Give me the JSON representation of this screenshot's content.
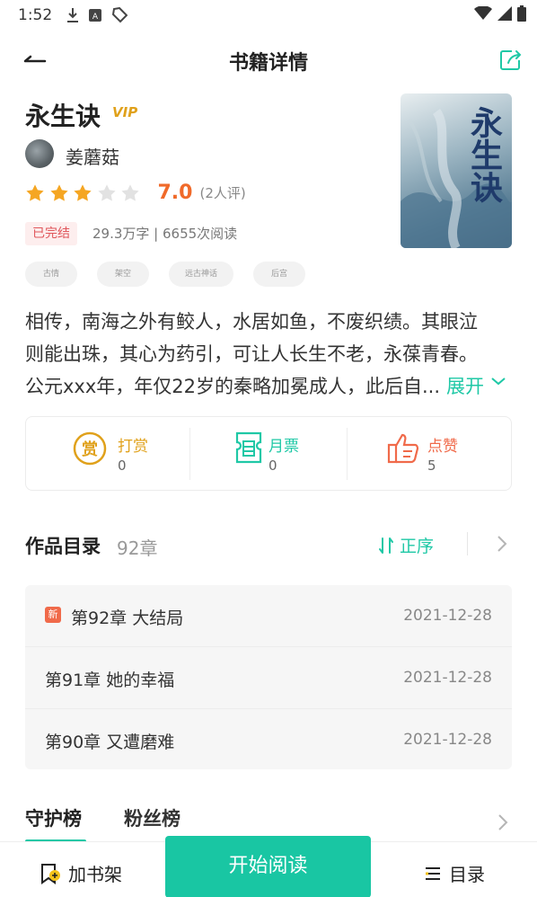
{
  "status_bar": {
    "time": "1:52"
  },
  "header": {
    "title": "书籍详情"
  },
  "book": {
    "title": "永生诀",
    "vip_label": "VIP",
    "author": "姜蘑菇",
    "rating": {
      "score": "7.0",
      "count": "(2人评)",
      "stars_filled": 3,
      "stars_total": 5
    },
    "status": "已完结",
    "meta": "29.3万字 | 6655次阅读",
    "tags": [
      "古情",
      "架空",
      "远古神话",
      "后宫"
    ],
    "cover": {
      "title": "永生诀",
      "publisher": ""
    },
    "synopsis_lines": [
      "相传，南海之外有鲛人，水居如鱼，不废织绩。其眼泣",
      "则能出珠，其心为药引，可让人长生不老，永葆青春。",
      "公元xxx年，年仅22岁的秦略加冕成人，此后自..."
    ],
    "expand_label": "展开"
  },
  "actions": [
    {
      "label": "打赏",
      "count": "0",
      "icon": "reward-icon"
    },
    {
      "label": "月票",
      "count": "0",
      "icon": "monthly-ticket-icon"
    },
    {
      "label": "点赞",
      "count": "5",
      "icon": "thumbs-up-icon"
    }
  ],
  "toc": {
    "title": "作品目录",
    "count": "92章",
    "sort_label": "正序",
    "chapters": [
      {
        "name": "第92章 大结局",
        "date": "2021-12-28",
        "badge": "新"
      },
      {
        "name": "第91章 她的幸福",
        "date": "2021-12-28"
      },
      {
        "name": "第90章 又遭磨难",
        "date": "2021-12-28"
      }
    ]
  },
  "rankings": {
    "tabs": [
      "守护榜",
      "粉丝榜"
    ]
  },
  "bottom_bar": {
    "shelf_label": "加书架",
    "start_label": "开始阅读",
    "toc_label": "目录"
  },
  "colors": {
    "accent": "#1fc8a6",
    "rating": "#f06a2a",
    "star": "#f5a623"
  }
}
